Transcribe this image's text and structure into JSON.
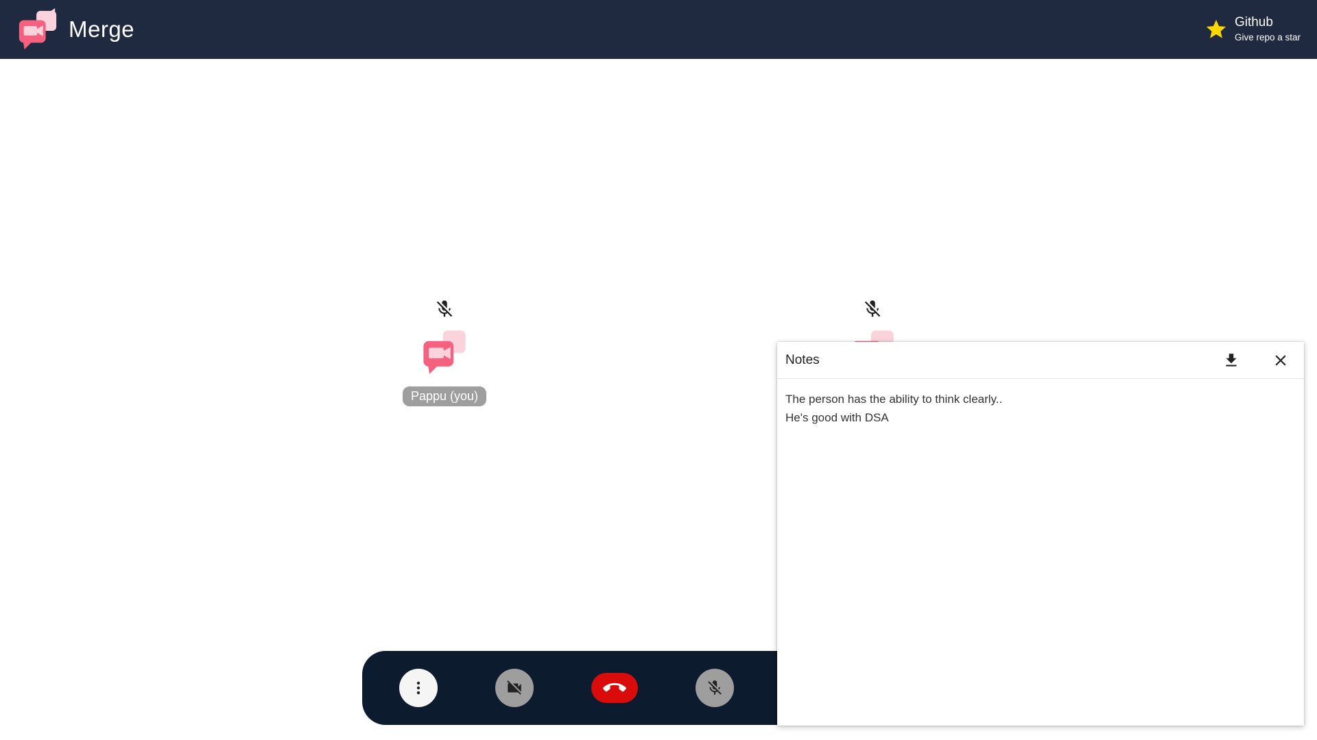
{
  "header": {
    "brand_name": "Merge",
    "github_title": "Github",
    "github_subtitle": "Give repo a star"
  },
  "participants": [
    {
      "name": "Pappu (you)",
      "muted": true
    },
    {
      "name": "",
      "muted": true
    }
  ],
  "controls": {
    "more": "more-options",
    "video": "video-off",
    "end": "end-call",
    "mic": "mic-off"
  },
  "notes": {
    "title": "Notes",
    "content": "The person has the ability to think clearly..\nHe's good with DSA"
  },
  "colors": {
    "header_bg": "#1f2a40",
    "control_bar_bg": "#0d1b2e",
    "end_call": "#d90b0b",
    "button_gray": "#9e9e9e",
    "brand_pink": "#f5617e",
    "star": "#ffd600"
  },
  "icons": [
    "merge-logo-icon",
    "star-icon",
    "mic-off-icon",
    "more-vert-icon",
    "video-off-icon",
    "call-end-icon",
    "download-icon",
    "close-icon"
  ]
}
